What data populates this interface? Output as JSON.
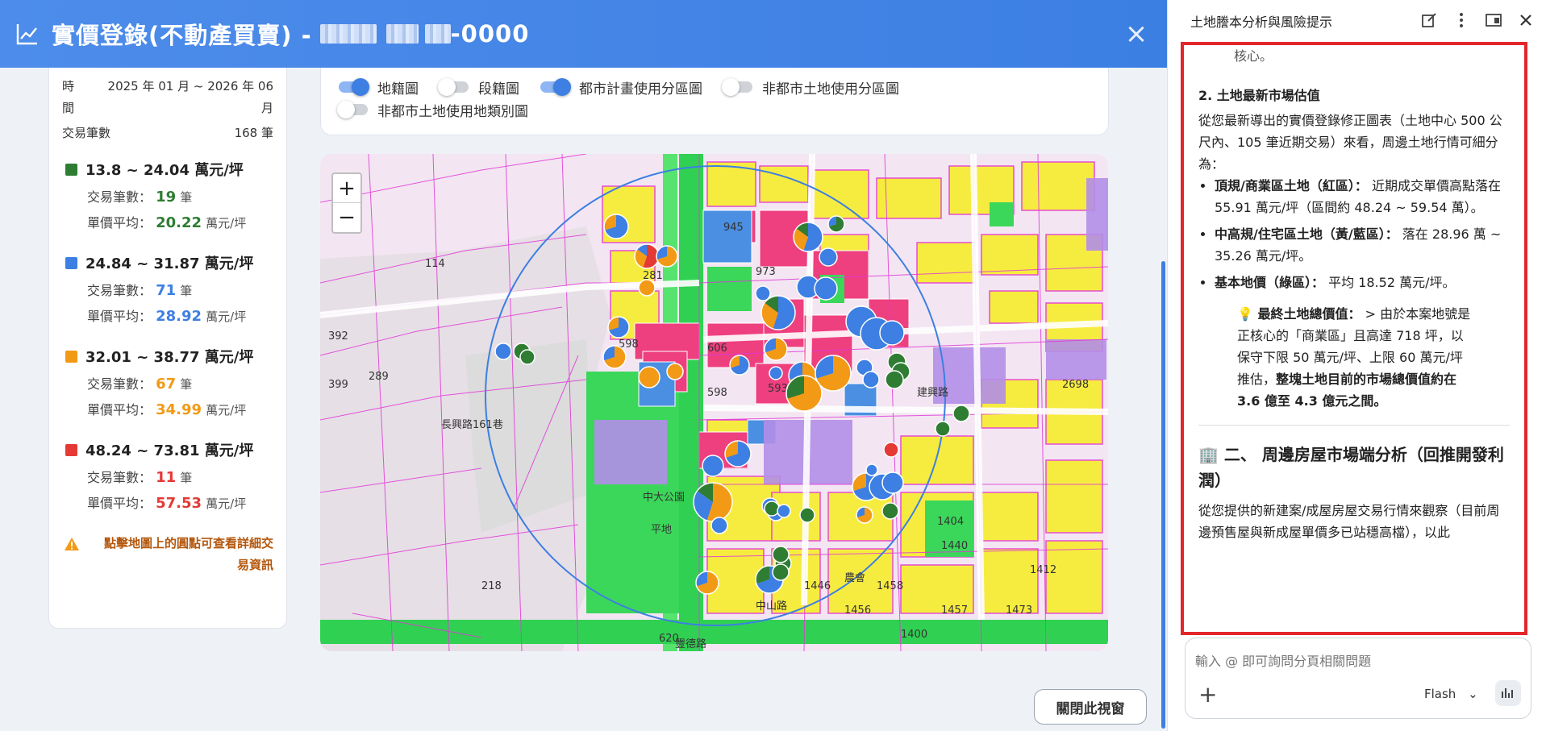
{
  "window": {
    "title_prefix": "實價登錄(不動產買賣) -",
    "title_suffix": "-0000",
    "close_label": "×",
    "close_button_label": "關閉此視窗"
  },
  "summary": {
    "time_label": "時間",
    "time_value": "2025 年 01 月 ~ 2026 年 06 月",
    "count_label": "交易筆數",
    "count_value": "168 筆",
    "txn_label": "交易筆數：",
    "avg_label": "單價平均：",
    "unit_count": "筆",
    "unit_price": "萬元/坪",
    "legend": [
      {
        "range": "13.8 ~ 24.04 萬元/坪",
        "count": "19",
        "avg": "20.22",
        "color": "#2e7d32"
      },
      {
        "range": "24.84 ~ 31.87 萬元/坪",
        "count": "71",
        "avg": "28.92",
        "color": "#3d7fe2"
      },
      {
        "range": "32.01 ~ 38.77 萬元/坪",
        "count": "67",
        "avg": "34.99",
        "color": "#f29a16"
      },
      {
        "range": "48.24 ~ 73.81 萬元/坪",
        "count": "11",
        "avg": "57.53",
        "color": "#e53935"
      }
    ],
    "hint": "點擊地圖上的圓點可查看詳細交易資訊"
  },
  "layers": [
    {
      "label": "地籍圖",
      "on": true
    },
    {
      "label": "段籍圖",
      "on": false
    },
    {
      "label": "都市計畫使用分區圖",
      "on": true
    },
    {
      "label": "非都市土地使用分區圖",
      "on": false
    },
    {
      "label": "非都市土地使用地類別圖",
      "on": false
    }
  ],
  "map": {
    "zoom_in": "+",
    "zoom_out": "−",
    "labels": [
      "945",
      "973",
      "606",
      "598",
      "593",
      "1404",
      "1440",
      "1400",
      "1456",
      "1457",
      "1458",
      "1446",
      "1473",
      "1412",
      "2698",
      "218",
      "289",
      "392",
      "399",
      "114",
      "620",
      "281",
      "598",
      "中大公園",
      "平地",
      "農會",
      "豐德路",
      "長興路161巷",
      "中山路",
      "建興路"
    ]
  },
  "panel": {
    "title": "土地謄本分析與風險提示",
    "content": {
      "top_fragment": "核心。",
      "section2_title": "2. 土地最新市場估值",
      "section2_intro": "從您最新導出的實價登錄修正圖表（土地中心 500 公尺內、105 筆近期交易）來看，周邊土地行情可細分為：",
      "bullets": [
        {
          "head": "頂規/商業區土地（紅區）：",
          "body": "近期成交單價高點落在 55.91 萬元/坪（區間約 48.24 ~ 59.54 萬）。"
        },
        {
          "head": "中高規/住宅區土地（黃/藍區）：",
          "body": "落在 28.96 萬 ~ 35.26 萬元/坪。"
        },
        {
          "head": "基本地價（綠區）：",
          "body": "平均 18.52 萬元/坪。"
        }
      ],
      "callout_head": "💡 最終土地總價值：",
      "callout_body": "> 由於本案地號是正核心的「商業區」且高達 718 坪，以保守下限 50 萬元/坪、上限 60 萬元/坪推估，",
      "callout_bold": "整塊土地目前的市場總價值約在 3.6 億至 4.3 億元之間。",
      "section_heading": "🏢 二、 周邊房屋市場端分析（回推開發利潤）",
      "section_body": "從您提供的新建案/成屋房屋交易行情來觀察（目前周邊預售屋與新成屋單價多已站穩高檔），以此"
    },
    "input_placeholder": "輸入 @ 即可詢問分頁相關問題",
    "add_label": "+",
    "model_label": "Flash"
  }
}
